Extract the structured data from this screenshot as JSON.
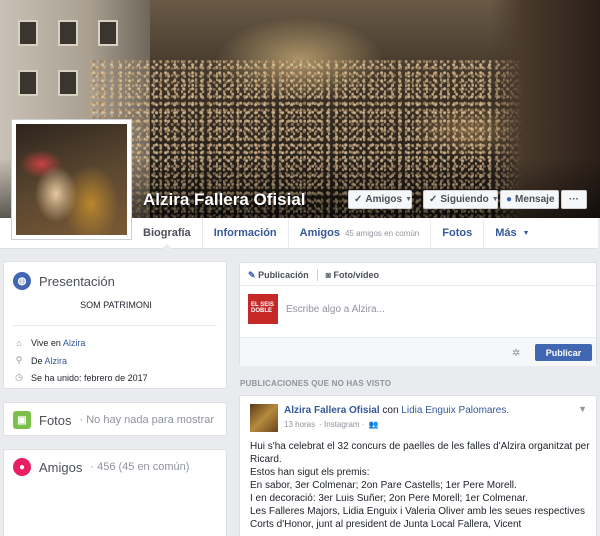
{
  "page": {
    "name": "Alzira Fallera Ofisial"
  },
  "header_buttons": {
    "friends": "Amigos",
    "following": "Siguiendo",
    "message": "Mensaje",
    "more": "···"
  },
  "nav": {
    "tabs": [
      {
        "label": "Biografía"
      },
      {
        "label": "Información"
      },
      {
        "label": "Amigos",
        "sub": "45 amigos en común"
      },
      {
        "label": "Fotos"
      },
      {
        "label": "Más"
      }
    ]
  },
  "intro": {
    "title": "Presentación",
    "motto": "SOM PATRIMONI",
    "lives_prefix": "Vive en",
    "lives_place": "Alzira",
    "from_prefix": "De",
    "from_place": "Alzira",
    "joined": "Se ha unido: febrero de 2017"
  },
  "photos": {
    "title": "Fotos",
    "empty": "· No hay nada para mostrar"
  },
  "friends": {
    "title": "Amigos",
    "count": "· 456 (45 en común)"
  },
  "composer": {
    "tab_post": "Publicación",
    "tab_photo": "Foto/vídeo",
    "placeholder": "Escribe algo a Alzira...",
    "avatar_text_1": "EL SEIS",
    "avatar_text_2": "DOBLE",
    "publish": "Publicar"
  },
  "feed": {
    "section_title": "PUBLICACIONES QUE NO HAS VISTO",
    "post": {
      "author": "Alzira Fallera Ofisial",
      "with_word": "con",
      "tagged": "Lidia Enguix Palomares.",
      "time": "13 horas",
      "via": "· Instagram ·",
      "lines": [
        "Hui s'ha celebrat el 32 concurs de paelles de les falles d'Alzira organitzat per Ricard.",
        "Estos han sigut els premis:",
        "En sabor, 3er Colmenar; 2on Pare Castells; 1er Pere Morell.",
        "I en decoració: 3er Luis Suñer; 2on Pere Morell; 1er Colmenar.",
        "Les Falleres Majors, Lidia Enguix i Valeria Oliver amb les seues respectives Corts d'Honor, junt al president de Junta Local Fallera, Vicent"
      ]
    }
  },
  "colors": {
    "brand": "#4267b2",
    "link": "#365899",
    "background": "#e9ebee"
  }
}
